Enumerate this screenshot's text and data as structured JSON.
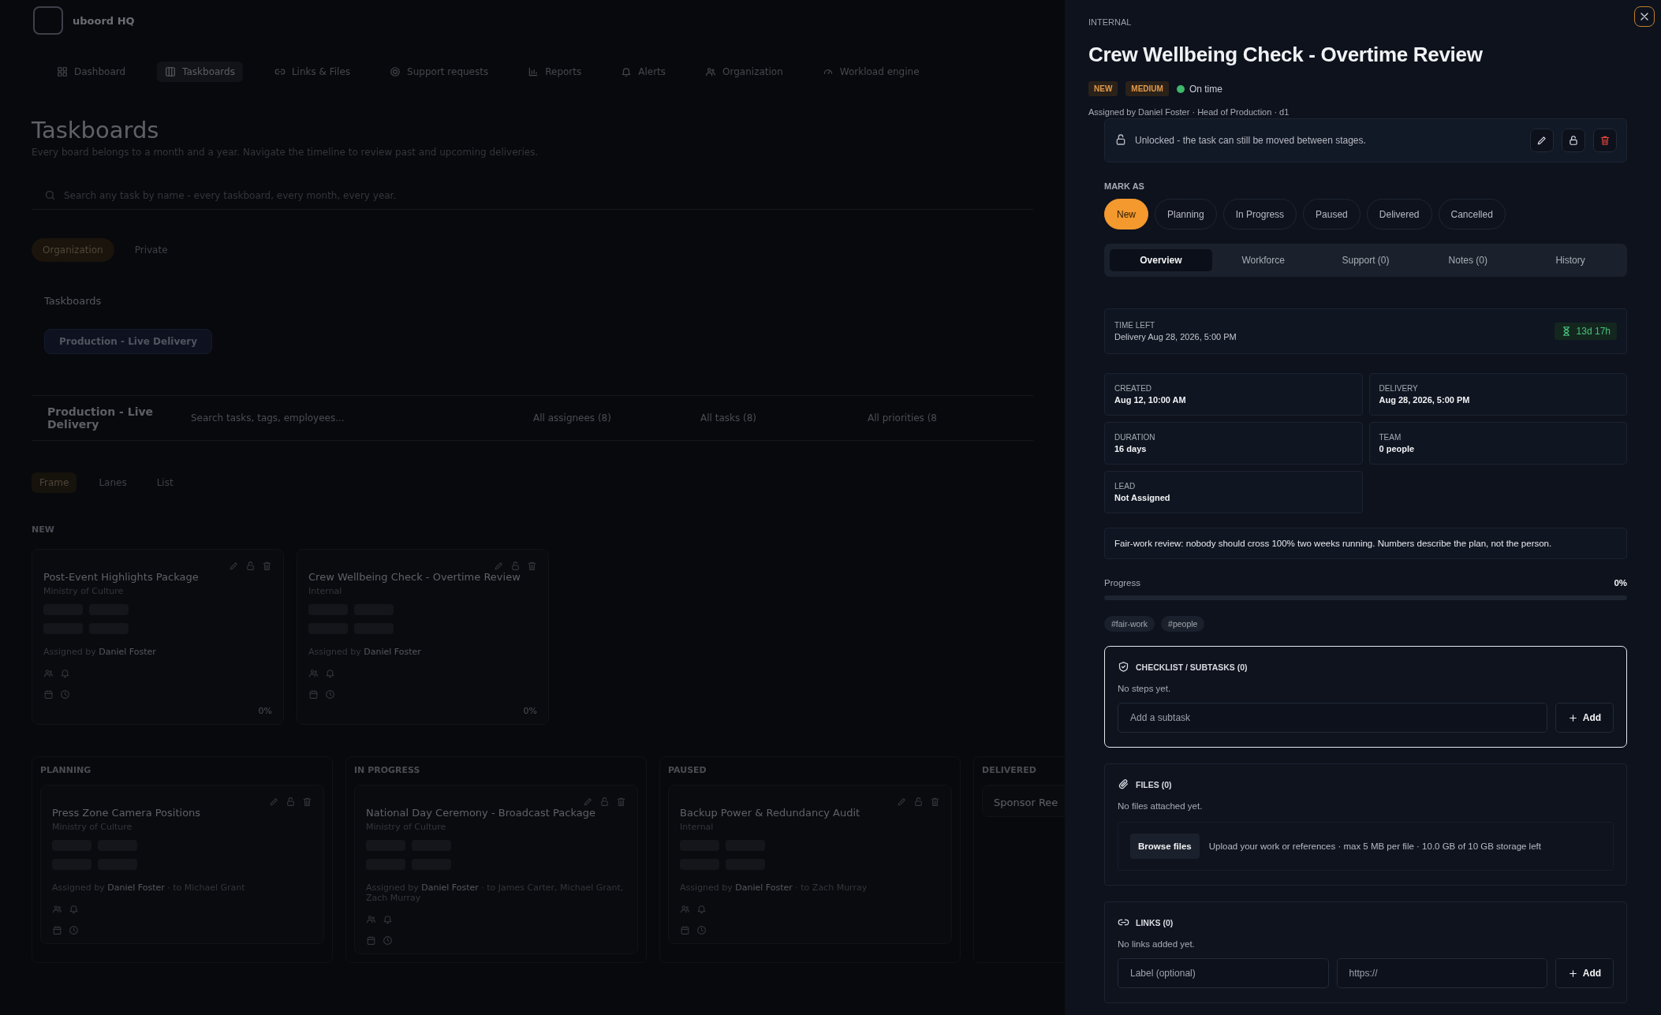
{
  "app": {
    "name": "uboord HQ"
  },
  "nav": [
    {
      "label": "Dashboard",
      "selected": false
    },
    {
      "label": "Taskboards",
      "selected": true
    },
    {
      "label": "Links & Files",
      "selected": false
    },
    {
      "label": "Support requests",
      "selected": false
    },
    {
      "label": "Reports",
      "selected": false
    },
    {
      "label": "Alerts",
      "selected": false
    },
    {
      "label": "Organization",
      "selected": false
    },
    {
      "label": "Workload engine",
      "selected": false
    }
  ],
  "page": {
    "title": "Taskboards",
    "subtitle": "Every board belongs to a month and a year. Navigate the timeline to review past and upcoming deliveries.",
    "search_placeholder": "Search any task by name - every taskboard, every month, every year."
  },
  "scope_tabs": [
    {
      "label": "Organization",
      "selected": true
    },
    {
      "label": "Private",
      "selected": false
    }
  ],
  "boards": {
    "heading": "Taskboards",
    "items": [
      {
        "label": "Production - Live Delivery",
        "selected": true
      }
    ]
  },
  "board_bar": {
    "title": "Production - Live Delivery",
    "search_placeholder": "Search tasks, tags, employees...",
    "filters": [
      "All assignees (8)",
      "All tasks (8)",
      "All priorities (8"
    ]
  },
  "views": [
    {
      "label": "Frame",
      "selected": true
    },
    {
      "label": "Lanes",
      "selected": false
    },
    {
      "label": "List",
      "selected": false
    }
  ],
  "stages": [
    {
      "label": "NEW",
      "cards": [
        {
          "title": "Post-Event Highlights Package",
          "client": "Ministry of Culture",
          "by_label": "Assigned by",
          "by": "Daniel Foster",
          "progress": "0%"
        },
        {
          "title": "Crew Wellbeing Check - Overtime Review",
          "client": "Internal",
          "by_label": "Assigned by",
          "by": "Daniel Foster",
          "progress": "0%"
        }
      ]
    },
    {
      "label": "PLANNING",
      "cards": [
        {
          "title": "Press Zone Camera Positions",
          "client": "Ministry of Culture",
          "by_label": "Assigned by",
          "by": "Daniel Foster",
          "to": "· to Michael Grant"
        }
      ]
    },
    {
      "label": "IN PROGRESS",
      "cards": [
        {
          "title": "National Day Ceremony - Broadcast Package",
          "client": "Ministry of Culture",
          "by_label": "Assigned by",
          "by": "Daniel Foster",
          "to": "· to James Carter, Michael Grant, Zach Murray"
        }
      ]
    },
    {
      "label": "PAUSED",
      "cards": [
        {
          "title": "Backup Power & Redundancy Audit",
          "client": "Internal",
          "by_label": "Assigned by",
          "by": "Daniel Foster",
          "to": "· to Zach Murray"
        }
      ]
    },
    {
      "label": "DELIVERED",
      "cards": [
        {
          "title": "Sponsor Ree"
        }
      ]
    }
  ],
  "task": {
    "client": "INTERNAL",
    "title": "Crew Wellbeing Check - Overtime Review",
    "badges": [
      "NEW",
      "MEDIUM"
    ],
    "status": {
      "label": "On time",
      "color": "#3fb86a"
    },
    "assigned": "Assigned by Daniel Foster · Head of Production · d1",
    "lock": {
      "locked": false,
      "text": "Unlocked - the task can still be moved between stages."
    },
    "mark_as": {
      "label": "MARK AS",
      "stages": [
        {
          "label": "New",
          "selected": true
        },
        {
          "label": "Planning",
          "selected": false
        },
        {
          "label": "In Progress",
          "selected": false
        },
        {
          "label": "Paused",
          "selected": false
        },
        {
          "label": "Delivered",
          "selected": false
        },
        {
          "label": "Cancelled",
          "selected": false
        }
      ]
    },
    "tabs": [
      {
        "label": "Overview",
        "selected": true
      },
      {
        "label": "Workforce",
        "selected": false
      },
      {
        "label": "Support (0)",
        "selected": false
      },
      {
        "label": "Notes (0)",
        "selected": false
      },
      {
        "label": "History",
        "selected": false
      }
    ],
    "time_left": {
      "label": "TIME LEFT",
      "detail": "Delivery Aug 28, 2026, 5:00 PM",
      "remaining": "13d 17h"
    },
    "facts": [
      {
        "label": "CREATED",
        "value": "Aug 12, 10:00 AM"
      },
      {
        "label": "DELIVERY",
        "value": "Aug 28, 2026, 5:00 PM"
      },
      {
        "label": "DURATION",
        "value": "16 days"
      },
      {
        "label": "TEAM",
        "value": "0 people"
      },
      {
        "label": "LEAD",
        "value": "Not Assigned"
      }
    ],
    "note": "Fair-work review: nobody should cross 100% two weeks running. Numbers describe the plan, not the person.",
    "progress": {
      "label": "Progress",
      "reading": "0%",
      "level": 0
    },
    "tags": [
      "#fair-work",
      "#people"
    ],
    "checklist": {
      "title": "CHECKLIST / SUBTASKS (0)",
      "empty": "No steps yet.",
      "placeholder": "Add a subtask",
      "button": "Add"
    },
    "files": {
      "title": "FILES (0)",
      "empty": "No files attached yet.",
      "button": "Browse files",
      "hint": "Upload your work or references · max 5 MB per file · 10.0 GB of 10 GB storage left"
    },
    "links": {
      "title": "LINKS (0)",
      "empty": "No links added yet.",
      "label_placeholder": "Label (optional)",
      "url_placeholder": "https://",
      "button": "Add"
    }
  }
}
